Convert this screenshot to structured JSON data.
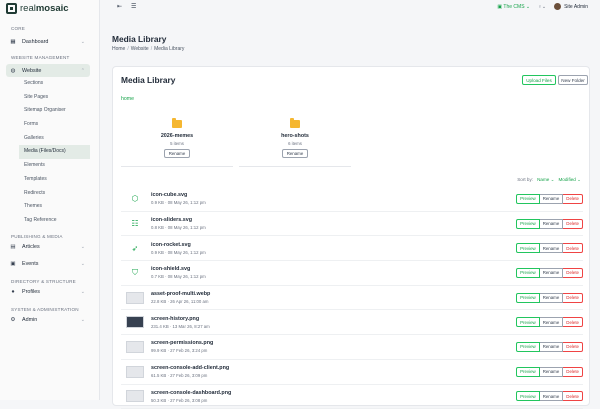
{
  "brand": {
    "real": "real",
    "mosaic": "mosaic"
  },
  "sidebar": {
    "core_label": "CORE",
    "dashboard": "Dashboard",
    "wm_label": "WEBSITE MANAGEMENT",
    "website": "Website",
    "subitems": [
      "Sections",
      "Site Pages",
      "Sitemap Organiser",
      "Forms",
      "Galleries",
      "Media (Files/Docs)",
      "Elements",
      "Templates",
      "Redirects",
      "Themes",
      "Tag Reference"
    ],
    "pm_label": "PUBLISHING & MEDIA",
    "articles": "Articles",
    "events": "Events",
    "ds_label": "DIRECTORY & STRUCTURE",
    "profiles": "Profiles",
    "sa_label": "SYSTEM & ADMINISTRATION",
    "admin": "Admin"
  },
  "topbar": {
    "cms": "The CMS",
    "user": "Site Admin"
  },
  "page": {
    "title": "Media Library",
    "crumb": [
      "Home",
      "Website",
      "Media Library"
    ]
  },
  "card": {
    "title": "Media Library",
    "upload": "Upload Files",
    "new_folder": "New Folder",
    "home_link": "home"
  },
  "folders": [
    {
      "name": "2026-memes",
      "count": "5 items",
      "rename": "Rename"
    },
    {
      "name": "hero-shots",
      "count": "6 items",
      "rename": "Rename"
    }
  ],
  "sort": {
    "label": "Sort by:",
    "name": "Name",
    "modified": "Modified"
  },
  "actions": {
    "preview": "Preview",
    "rename": "Rename",
    "delete": "Delete"
  },
  "files": [
    {
      "name": "icon-cube.svg",
      "meta": "0.9 KB · 08 May 26, 1:12 pm",
      "icon": "cube-icon"
    },
    {
      "name": "icon-sliders.svg",
      "meta": "0.8 KB · 08 May 26, 1:12 pm",
      "icon": "sliders-icon"
    },
    {
      "name": "icon-rocket.svg",
      "meta": "0.9 KB · 08 May 26, 1:12 pm",
      "icon": "rocket-icon"
    },
    {
      "name": "icon-shield.svg",
      "meta": "0.7 KB · 08 May 26, 1:12 pm",
      "icon": "shield-icon"
    },
    {
      "name": "asset-proof-multi.webp",
      "meta": "22.8 KB · 26 Apr 26, 11:00 am",
      "icon": "image-thumb"
    },
    {
      "name": "screen-history.png",
      "meta": "231.4 KB · 13 Mar 26, 8:27 am",
      "icon": "image-thumb"
    },
    {
      "name": "screen-permissions.png",
      "meta": "99.9 KB · 27 Feb 26, 3:24 pm",
      "icon": "image-thumb"
    },
    {
      "name": "screen-console-add-client.png",
      "meta": "61.5 KB · 27 Feb 26, 3:09 pm",
      "icon": "image-thumb"
    },
    {
      "name": "screen-console-dashboard.png",
      "meta": "50.3 KB · 27 Feb 26, 3:08 pm",
      "icon": "image-thumb"
    }
  ]
}
